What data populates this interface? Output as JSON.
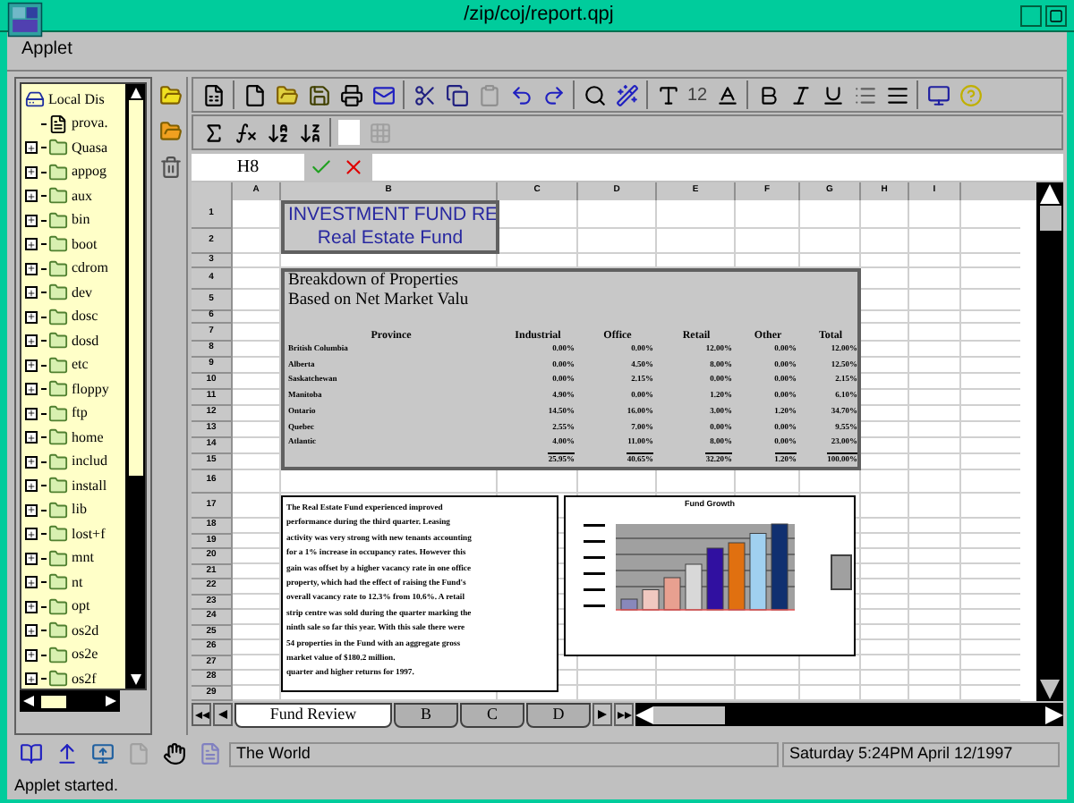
{
  "window": {
    "title": "/zip/coj/report.qpj"
  },
  "menu": [
    "Applet"
  ],
  "tree": [
    {
      "kind": "drive",
      "label": "Local Dis"
    },
    {
      "kind": "file",
      "label": "prova."
    },
    {
      "kind": "folder",
      "label": "Quasa",
      "expanded": false
    },
    {
      "kind": "folder",
      "label": "appog",
      "expanded": false
    },
    {
      "kind": "folder",
      "label": "aux",
      "expanded": false
    },
    {
      "kind": "folder",
      "label": "bin",
      "expanded": false
    },
    {
      "kind": "folder",
      "label": "boot",
      "expanded": false
    },
    {
      "kind": "folder",
      "label": "cdrom",
      "expanded": false
    },
    {
      "kind": "folder",
      "label": "dev",
      "expanded": false
    },
    {
      "kind": "folder",
      "label": "dosc",
      "expanded": false
    },
    {
      "kind": "folder",
      "label": "dosd",
      "expanded": false
    },
    {
      "kind": "folder",
      "label": "etc",
      "expanded": false
    },
    {
      "kind": "folder",
      "label": "floppy",
      "expanded": false
    },
    {
      "kind": "folder",
      "label": "ftp",
      "expanded": false
    },
    {
      "kind": "folder",
      "label": "home",
      "expanded": false
    },
    {
      "kind": "folder",
      "label": "includ",
      "expanded": false
    },
    {
      "kind": "folder",
      "label": "install",
      "expanded": false
    },
    {
      "kind": "folder",
      "label": "lib",
      "expanded": false
    },
    {
      "kind": "folder",
      "label": "lost+f",
      "expanded": false
    },
    {
      "kind": "folder",
      "label": "mnt",
      "expanded": false
    },
    {
      "kind": "folder",
      "label": "nt",
      "expanded": false
    },
    {
      "kind": "folder",
      "label": "opt",
      "expanded": false
    },
    {
      "kind": "folder",
      "label": "os2d",
      "expanded": false
    },
    {
      "kind": "folder",
      "label": "os2e",
      "expanded": false
    },
    {
      "kind": "folder",
      "label": "os2f",
      "expanded": false
    }
  ],
  "toolbar": {
    "font_size": "12"
  },
  "formula_bar": {
    "cell": "H8"
  },
  "sheet": {
    "columns": [
      "A",
      "B",
      "C",
      "D",
      "E",
      "F",
      "G",
      "H",
      "I"
    ],
    "rows": [
      "1",
      "2",
      "3",
      "4",
      "5",
      "6",
      "7",
      "8",
      "9",
      "10",
      "11",
      "12",
      "13",
      "14",
      "15",
      "16",
      "17",
      "18",
      "19",
      "20",
      "21",
      "22",
      "23",
      "24",
      "25",
      "26",
      "27",
      "28",
      "29"
    ],
    "title": {
      "line_1": "INVESTMENT FUND RE",
      "line_2": "Real Estate Fund"
    },
    "breakdown": {
      "heading_1": "Breakdown of Properties",
      "heading_2": "Based on Net Market Valu",
      "columns": [
        "Province",
        "Industrial",
        "Office",
        "Retail",
        "Other",
        "Total"
      ],
      "rows": [
        {
          "province": "British Columbia",
          "values": [
            "0.00%",
            "0.00%",
            "12.00%",
            "0.00%",
            "12.00%"
          ]
        },
        {
          "province": "Alberta",
          "values": [
            "0.00%",
            "4.50%",
            "8.00%",
            "0.00%",
            "12.50%"
          ]
        },
        {
          "province": "Saskatchewan",
          "values": [
            "0.00%",
            "2.15%",
            "0.00%",
            "0.00%",
            "2.15%"
          ]
        },
        {
          "province": "Manitoba",
          "values": [
            "4.90%",
            "0.00%",
            "1.20%",
            "0.00%",
            "6.10%"
          ]
        },
        {
          "province": "Ontario",
          "values": [
            "14.50%",
            "16.00%",
            "3.00%",
            "1.20%",
            "34.70%"
          ]
        },
        {
          "province": "Quebec",
          "values": [
            "2.55%",
            "7.00%",
            "0.00%",
            "0.00%",
            "9.55%"
          ]
        },
        {
          "province": "Atlantic",
          "values": [
            "4.00%",
            "11.00%",
            "8.00%",
            "0.00%",
            "23.00%"
          ]
        }
      ],
      "totals": [
        "25.95%",
        "40.65%",
        "32.20%",
        "1.20%",
        "100.00%"
      ]
    },
    "commentary": {
      "lines": [
        "The Real Estate Fund experienced improved",
        "performance during the third quarter. Leasing",
        "activity was very strong with new tenants accounting",
        "for a 1% increase in occupancy rates. However this",
        "gain was offset by a higher vacancy rate in one office",
        "property, which had the effect of raising the Fund's",
        "overall vacancy rate to 12.3% from 10.6%. A retail",
        "strip centre was sold during the quarter marking the",
        "ninth sale so far this year. With this sale there were",
        "54 properties in the Fund with an aggregate gross",
        "market value of $180.2 million.",
        "quarter and higher returns for 1997."
      ]
    },
    "chart": {
      "title": "Fund Growth"
    }
  },
  "sheet_tabs": [
    {
      "label": "Fund Review",
      "selected": true
    },
    {
      "label": "B",
      "selected": false
    },
    {
      "label": "C",
      "selected": false
    },
    {
      "label": "D",
      "selected": false
    }
  ],
  "status_bar": {
    "location": "The World",
    "datetime": "Saturday 5:24PM April 12/1997",
    "message": "Applet started."
  }
}
